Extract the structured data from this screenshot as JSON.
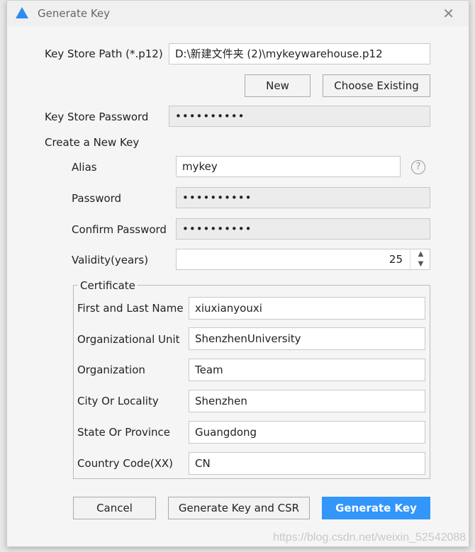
{
  "title": "Generate Key",
  "keystore": {
    "path_label": "Key Store Path (*.p12)",
    "path_value": "D:\\新建文件夹 (2)\\mykeywarehouse.p12",
    "new_label": "New",
    "choose_label": "Choose Existing",
    "password_label": "Key Store Password",
    "password_value": "••••••••••"
  },
  "new_key": {
    "heading": "Create a New Key",
    "alias_label": "Alias",
    "alias_value": "mykey",
    "password_label": "Password",
    "password_value": "••••••••••",
    "confirm_label": "Confirm Password",
    "confirm_value": "••••••••••",
    "validity_label": "Validity(years)",
    "validity_value": "25"
  },
  "certificate": {
    "title": "Certificate",
    "fields": [
      {
        "label": "First and Last Name",
        "value": "xiuxianyouxi"
      },
      {
        "label": "Organizational Unit",
        "value": "ShenzhenUniversity"
      },
      {
        "label": "Organization",
        "value": "Team"
      },
      {
        "label": "City Or Locality",
        "value": "Shenzhen"
      },
      {
        "label": "State Or Province",
        "value": "Guangdong"
      },
      {
        "label": "Country Code(XX)",
        "value": "CN"
      }
    ]
  },
  "buttons": {
    "cancel": "Cancel",
    "csr": "Generate Key and CSR",
    "generate": "Generate Key"
  },
  "watermark": "https://blog.csdn.net/weixin_52542088",
  "colors": {
    "primary": "#3296fa"
  }
}
